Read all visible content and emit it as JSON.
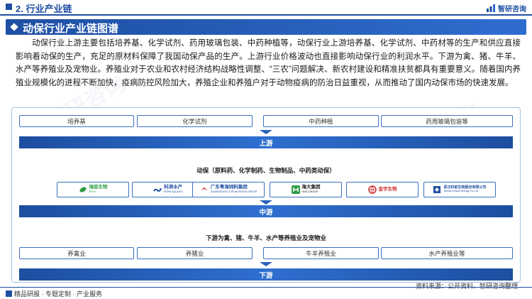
{
  "header": {
    "section_title": "2. 行业产业链",
    "logo_text": "智研咨询"
  },
  "title_bar": {
    "title": "动保行业产业链图谱"
  },
  "paragraph": "动保行业上游主要包括培养基、化学试剂、药用玻璃包装、中药种植等，动保行业上游培养基、化学试剂、中药材等的生产和供应直接影响着动保的生产，充足的原材料保障了我国动保产品的生产。上游行业价格波动也直接影响动保行业的利润水平。下游为禽、猪、牛羊、水产等养殖业及宠物业。养殖业对于农业和农村经济结构战略性调整、“三农”问题解决、新农村建设和精准扶贫都具有重要意义。随着国内养殖业规模化的进程不断加快，疫病防控风险加大，养殖企业和养殖户对于动物疫病的防治日益重视，从而推动了国内动保市场的快速发展。",
  "upstream": {
    "items": [
      "培养基",
      "化学试剂",
      "中药种植",
      "药用玻璃包装等"
    ],
    "band_label": "上游"
  },
  "midstream": {
    "label": "动保（原料药、化学制药、生物制品、中药类动保）",
    "companies": [
      {
        "name": "瑞普生物",
        "sub": "REPU",
        "color": "#2f9e44",
        "icon": "leaf-icon"
      },
      {
        "name": "科湃水产",
        "sub": "KEPAI AQUATIC",
        "color": "#1f4fa3",
        "icon": "wave-icon"
      },
      {
        "name": "广东粤海饲料集团",
        "sub": "GUANGDONG YUEHAI FEEDS GROUP",
        "color": "#1f4fa3",
        "icon": "bird-icon"
      },
      {
        "name": "海大集团",
        "sub": "HAID GROUP",
        "color": "#1a1a1a",
        "icon": "h-icon"
      },
      {
        "name": "金宇生物",
        "sub": "",
        "color": "#d03030",
        "icon": "globe-icon"
      },
      {
        "name": "武汉科前生物股份有限公司",
        "sub": "Wuhan Keqian Biology Co.,Ltd",
        "color": "#1f4fa3",
        "icon": "cube-icon"
      }
    ],
    "band_label": "中游"
  },
  "downstream": {
    "label": "下游为禽、猪、牛羊、水产等养殖业及宠物业",
    "items": [
      "养禽业",
      "养猪业",
      "牛羊养殖业",
      "水产养殖业等"
    ],
    "band_label": "下游"
  },
  "footer": {
    "left": "精品研报 · 专题定制 · 产业服务",
    "source": "资料来源：公开资料、智研咨询整理"
  },
  "watermark": "智研咨询",
  "colors": {
    "primary": "#1f4fa3",
    "accent": "#2e6dcf",
    "border": "#3b6fbf"
  }
}
